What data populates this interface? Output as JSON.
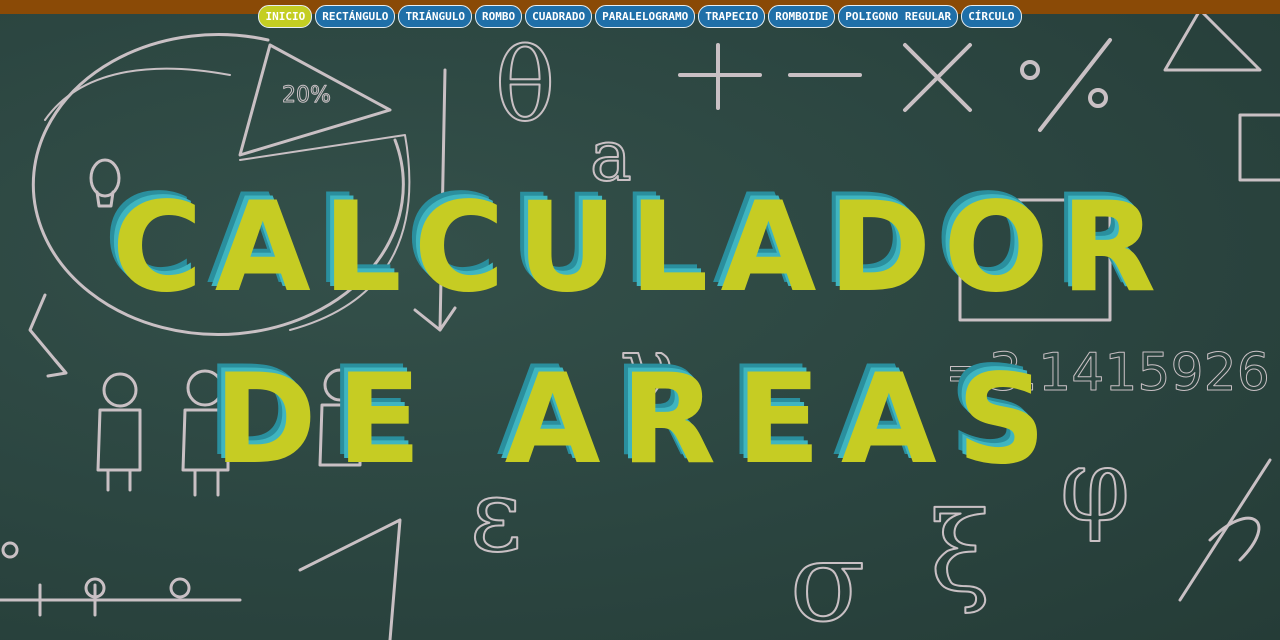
{
  "nav": {
    "items": [
      {
        "label": "INICIO",
        "active": true
      },
      {
        "label": "RECTÁNGULO"
      },
      {
        "label": "TRIÁNGULO"
      },
      {
        "label": "ROMBO"
      },
      {
        "label": "CUADRADO"
      },
      {
        "label": "PARALELOGRAMO"
      },
      {
        "label": "TRAPECIO"
      },
      {
        "label": "ROMBOIDE"
      },
      {
        "label": "POLIGONO REGULAR"
      },
      {
        "label": "CÍRCULO"
      }
    ]
  },
  "hero": {
    "line1": "CALCULADOR",
    "line2": "DE AREAS"
  },
  "chalk_text": {
    "percent": "20%",
    "pi_digits": "=3.1415926",
    "theta": "θ",
    "alpha": "a",
    "sigma": "σ",
    "epsilon": "ε",
    "gamma": "γ",
    "phi": "φ",
    "xi": "ξ"
  },
  "colors": {
    "board": "#2b4540",
    "topbar": "#8a4a06",
    "nav_button": "#1f6fa8",
    "nav_active": "#c4ce22",
    "title": "#c6cc23",
    "title_shadow": "#3fb5c0"
  }
}
